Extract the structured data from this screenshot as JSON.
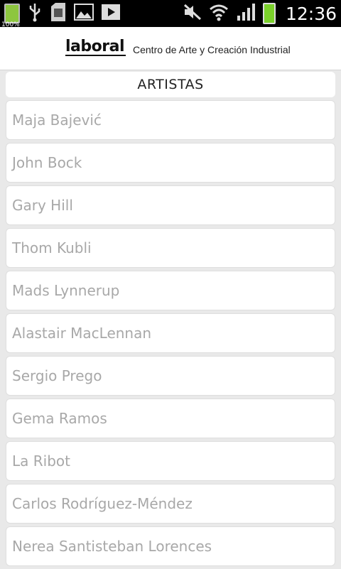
{
  "status_bar": {
    "battery_small_label": "100%",
    "time": "12:36"
  },
  "header": {
    "logo_text": "laboral",
    "subtitle": "Centro de Arte y Creación Industrial"
  },
  "section": {
    "title": "ARTISTAS"
  },
  "artists": [
    "Maja Bajević",
    "John Bock",
    "Gary Hill",
    "Thom Kubli",
    "Mads Lynnerup",
    "Alastair MacLennan",
    "Sergio Prego",
    "Gema Ramos",
    "La Ribot",
    "Carlos Rodríguez-Méndez",
    "Nerea Santisteban Lorences"
  ],
  "colors": {
    "status_bar_bg": "#000000",
    "page_bg": "#e9e9e9",
    "item_text": "#a8a8a8",
    "battery_green": "#7bd12b"
  }
}
